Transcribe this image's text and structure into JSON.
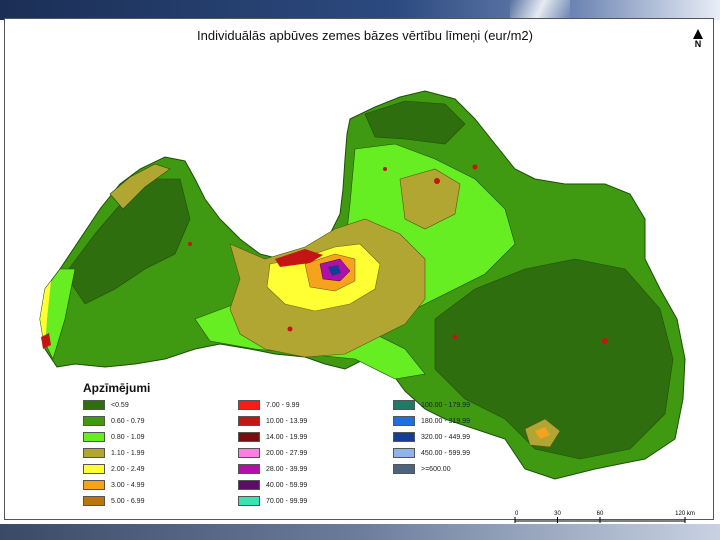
{
  "map": {
    "title": "Individuālās apbūves zemes bāzes vērtību līmeņi (eur/m2)",
    "north_label": "N"
  },
  "legend": {
    "title": "Apzīmējumi",
    "items": [
      {
        "label": "<0.59",
        "color": "#2f6e0f"
      },
      {
        "label": "0.60 - 0.79",
        "color": "#3f9a12"
      },
      {
        "label": "0.80 - 1.09",
        "color": "#66ee22"
      },
      {
        "label": "1.10 - 1.99",
        "color": "#b1a632"
      },
      {
        "label": "2.00 - 2.49",
        "color": "#ffff33"
      },
      {
        "label": "3.00 - 4.99",
        "color": "#f5a21d"
      },
      {
        "label": "5.00 - 6.99",
        "color": "#b8760c"
      },
      {
        "label": "7.00 - 9.99",
        "color": "#ff1a1a"
      },
      {
        "label": "10.00 - 13.99",
        "color": "#c41414"
      },
      {
        "label": "14.00 - 19.99",
        "color": "#7a0d0d"
      },
      {
        "label": "20.00 - 27.99",
        "color": "#ff7de0"
      },
      {
        "label": "28.00 - 39.99",
        "color": "#b00fa8"
      },
      {
        "label": "40.00 - 59.99",
        "color": "#5c0d66"
      },
      {
        "label": "70.00 - 99.99",
        "color": "#33e6b0"
      },
      {
        "label": "100.00 - 179.99",
        "color": "#207a66"
      },
      {
        "label": "180.00 - 319.99",
        "color": "#1f6fe0"
      },
      {
        "label": "320.00 - 449.99",
        "color": "#163d94"
      },
      {
        "label": "450.00 - 599.99",
        "color": "#8fb4e8"
      },
      {
        "label": ">=600.00",
        "color": "#4d6480"
      }
    ]
  },
  "scalebar": {
    "ticks": [
      "0",
      "30",
      "60",
      "120 km"
    ]
  }
}
